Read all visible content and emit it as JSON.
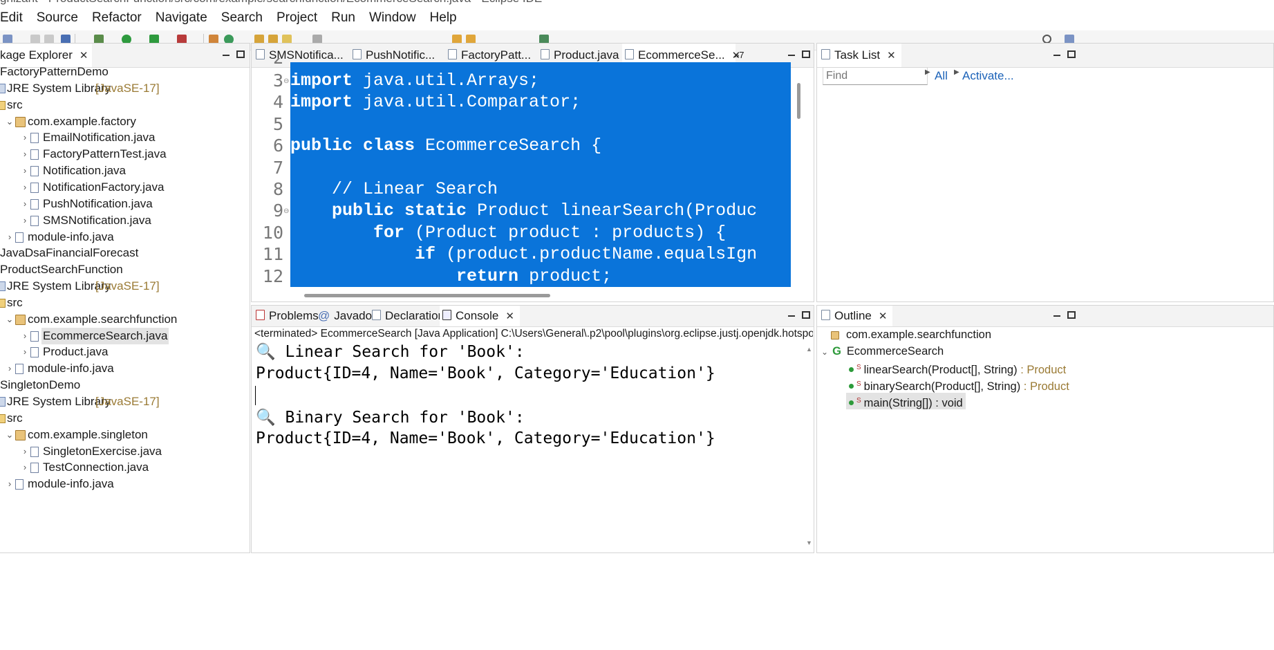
{
  "window": {
    "title": "gnizant - ProductSearchFunction/src/com/example/searchfunction/EcommerceSearch.java - Eclipse IDE"
  },
  "menu": [
    "Edit",
    "Source",
    "Refactor",
    "Navigate",
    "Search",
    "Project",
    "Run",
    "Window",
    "Help"
  ],
  "package_explorer": {
    "title": "kage Explorer",
    "rows": [
      {
        "label": "FactoryPatternDemo"
      },
      {
        "label": "JRE System Library",
        "tag": "[JavaSE-17]"
      },
      {
        "label": "src"
      },
      {
        "label": "com.example.factory"
      },
      {
        "label": "EmailNotification.java"
      },
      {
        "label": "FactoryPatternTest.java"
      },
      {
        "label": "Notification.java"
      },
      {
        "label": "NotificationFactory.java"
      },
      {
        "label": "PushNotification.java"
      },
      {
        "label": "SMSNotification.java"
      },
      {
        "label": "module-info.java"
      },
      {
        "label": "JavaDsaFinancialForecast"
      },
      {
        "label": "ProductSearchFunction"
      },
      {
        "label": "JRE System Library",
        "tag": "[JavaSE-17]"
      },
      {
        "label": "src"
      },
      {
        "label": "com.example.searchfunction"
      },
      {
        "label": "EcommerceSearch.java"
      },
      {
        "label": "Product.java"
      },
      {
        "label": "module-info.java"
      },
      {
        "label": "SingletonDemo"
      },
      {
        "label": "JRE System Library",
        "tag": "[JavaSE-17]"
      },
      {
        "label": "src"
      },
      {
        "label": "com.example.singleton"
      },
      {
        "label": "SingletonExercise.java"
      },
      {
        "label": "TestConnection.java"
      },
      {
        "label": "module-info.java"
      }
    ]
  },
  "editor": {
    "tabs": [
      "SMSNotifica...",
      "PushNotific...",
      "FactoryPatt...",
      "Product.java",
      "EcommerceSe..."
    ],
    "overflow": "»7",
    "lines": [
      {
        "num": "2",
        "code": ""
      },
      {
        "num": "3",
        "code": "import java.util.Arrays;"
      },
      {
        "num": "4",
        "code": "import java.util.Comparator;"
      },
      {
        "num": "5",
        "code": ""
      },
      {
        "num": "6",
        "code": "public class EcommerceSearch {"
      },
      {
        "num": "7",
        "code": ""
      },
      {
        "num": "8",
        "code": "    // Linear Search"
      },
      {
        "num": "9",
        "code": "    public static Product linearSearch(Produc"
      },
      {
        "num": "10",
        "code": "        for (Product product : products) {"
      },
      {
        "num": "11",
        "code": "            if (product.productName.equalsIgn"
      },
      {
        "num": "12",
        "code": "                return product;"
      }
    ]
  },
  "task_list": {
    "title": "Task List",
    "find_placeholder": "Find",
    "all_label": "All",
    "activate_label": "Activate..."
  },
  "console": {
    "tabs": [
      "Problems",
      "Javadoc",
      "Declaration",
      "Console"
    ],
    "status": "<terminated> EcommerceSearch [Java Application] C:\\Users\\General\\.p2\\pool\\plugins\\org.eclipse.justj.openjdk.hotspot.jre",
    "lines": [
      "🔍 Linear Search for 'Book':",
      "Product{ID=4, Name='Book', Category='Education'}",
      "",
      "🔍 Binary Search for 'Book':",
      "Product{ID=4, Name='Book', Category='Education'}"
    ]
  },
  "outline": {
    "title": "Outline",
    "package": "com.example.searchfunction",
    "class": "EcommerceSearch",
    "methods": [
      {
        "sig": "linearSearch(Product[], String)",
        "ret": " : Product"
      },
      {
        "sig": "binarySearch(Product[], String)",
        "ret": " : Product"
      },
      {
        "sig": "main(String[]) : void",
        "ret": ""
      }
    ]
  }
}
